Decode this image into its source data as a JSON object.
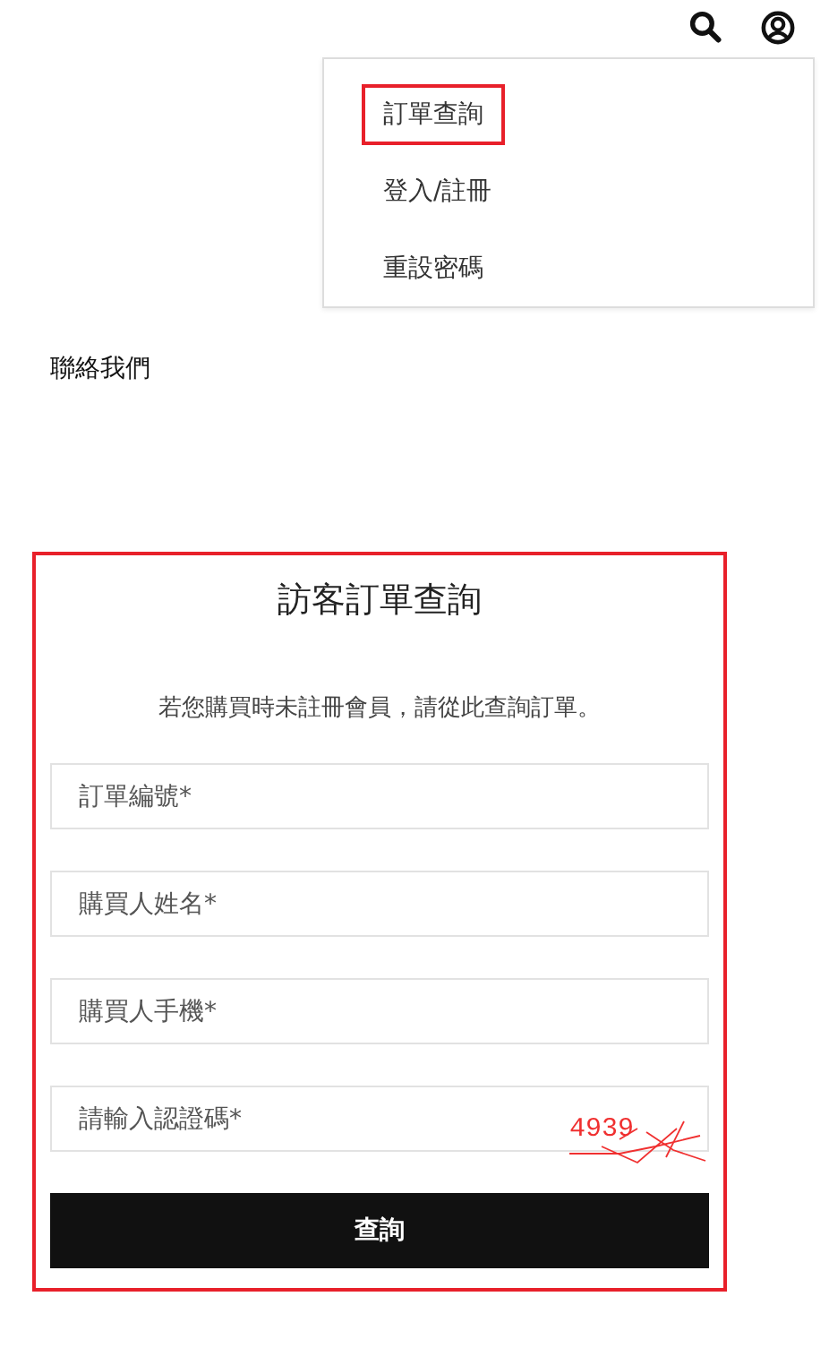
{
  "header": {
    "icons": [
      {
        "kind": "search"
      },
      {
        "kind": "account"
      }
    ]
  },
  "account_menu": {
    "items": [
      {
        "label": "訂單查詢",
        "highlighted": true
      },
      {
        "label": "登入/註冊",
        "highlighted": false
      },
      {
        "label": "重設密碼",
        "highlighted": false
      }
    ]
  },
  "contact_link": "聯絡我們",
  "order_lookup": {
    "highlighted": true,
    "title": "訪客訂單查詢",
    "description": "若您購買時未註冊會員，請從此查詢訂單。",
    "fields": [
      {
        "placeholder": "訂單編號*"
      },
      {
        "placeholder": "購買人姓名*"
      },
      {
        "placeholder": "購買人手機*"
      },
      {
        "placeholder": "請輸入認證碼*",
        "captcha": "4939"
      }
    ],
    "submit": "查詢"
  }
}
